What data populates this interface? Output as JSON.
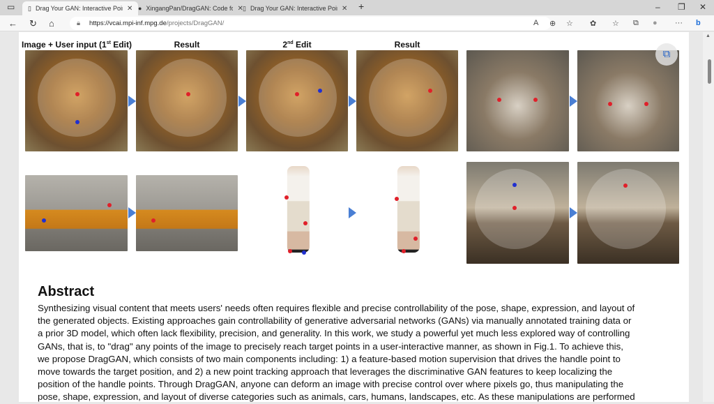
{
  "browser": {
    "tabs": [
      {
        "title": "Drag Your GAN: Interactive Point",
        "icon": "page-icon",
        "active": true
      },
      {
        "title": "XingangPan/DragGAN: Code for",
        "icon": "github-icon",
        "active": false
      },
      {
        "title": "Drag Your GAN: Interactive Point",
        "icon": "page-icon",
        "active": false
      }
    ],
    "new_tab": "+",
    "url_host": "https://vcai.mpi-inf.mpg.de",
    "url_path": "/projects/DragGAN/"
  },
  "figure": {
    "captions": [
      {
        "main": "Image + User input (1",
        "sup": "st",
        "tail": " Edit)"
      },
      {
        "main": "Result"
      },
      {
        "main": "2",
        "sup": "nd",
        "tail": " Edit"
      },
      {
        "main": "Result"
      }
    ],
    "handle_color": "#e0202a",
    "target_color": "#2030d0",
    "arrow_color": "#4a7fd4"
  },
  "abstract": {
    "heading": "Abstract",
    "lines": [
      "Synthesizing visual content that meets users' needs often requires flexible and precise controllability of the pose, shape, expression, and layout of",
      "the generated objects. Existing approaches gain controllability of generative adversarial networks (GANs) via manually annotated training data or",
      "a prior 3D model, which often lack flexibility, precision, and generality. In this work, we study a powerful yet much less explored way of controlling",
      "GANs, that is, to \"drag\" any points of the image to precisely reach target points in a user-interactive manner, as shown in Fig.1. To achieve this,",
      "we propose DragGAN, which consists of two main components including: 1) a feature-based motion supervision that drives the handle point to",
      "move towards the target position, and 2) a new point tracking approach that leverages the discriminative GAN features to keep localizing the",
      "position of the handle points. Through DragGAN, anyone can deform an image with precise control over where pixels go, thus manipulating the",
      "pose, shape, expression, and layout of diverse categories such as animals, cars, humans, landscapes, etc. As these manipulations are performed"
    ]
  }
}
